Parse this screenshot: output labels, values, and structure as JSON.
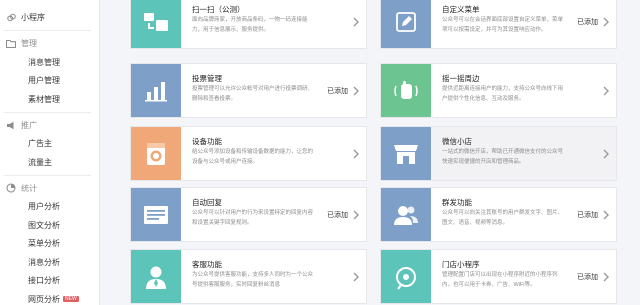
{
  "sidebar": {
    "top_item": {
      "label": "小程序",
      "icon": "mini-program-icon"
    },
    "groups": [
      {
        "title": "管理",
        "icon": "folder-icon",
        "items": [
          "消息管理",
          "用户管理",
          "素材管理"
        ]
      },
      {
        "title": "推广",
        "icon": "megaphone-icon",
        "items": [
          "广告主",
          "流量主"
        ]
      },
      {
        "title": "统计",
        "icon": "pie-chart-icon",
        "items": [
          "用户分析",
          "图文分析",
          "菜单分析",
          "消息分析",
          "接口分析",
          "网页分析"
        ]
      }
    ],
    "new_badge": "NEW"
  },
  "cards": [
    {
      "title": "扫一扫（公测）",
      "desc": "面向品牌商家，开放商品条码，一物一码连接能力，用于信息展示、服务提供。",
      "status": "",
      "color": "#5cc4b9",
      "icon": "scan-icon"
    },
    {
      "title": "自定义菜单",
      "desc": "公众号可以在会话界面底部设置自定义菜单，菜单项可以按需设定，并可为其设置响应动作。",
      "status": "已添加",
      "color": "#7d9fc8",
      "icon": "edit-icon"
    },
    {
      "title": "投票管理",
      "desc": "投票管理可以允许公众帐号对用户进行投票调研、删除和查看投票。",
      "status": "已添加",
      "color": "#7d9fc8",
      "icon": "bar-chart-icon"
    },
    {
      "title": "摇一摇周边",
      "desc": "提供近距离连接用户的能力，支持公众号向线下用户提供个性化信息、互动及服务。",
      "status": "",
      "color": "#6cc490",
      "icon": "shake-hand-icon"
    },
    {
      "title": "设备功能",
      "desc": "给公众号添加设备和传输设备数据的能力，让您的设备与公众号或用户连接。",
      "status": "",
      "color": "#f0a878",
      "icon": "washing-machine-icon"
    },
    {
      "title": "微信小店",
      "desc": "一站式的微信开店，帮助已开通微信支付的公众号快速实现便捷的开店和管理商品。",
      "status": "",
      "color": "#7d9fc8",
      "icon": "shop-icon"
    },
    {
      "title": "自动回复",
      "desc": "公众号可以针对用户的行为来设置特定的回复内容和设置关键字回复规则。",
      "status": "已添加",
      "color": "#7d9fc8",
      "icon": "auto-reply-icon"
    },
    {
      "title": "群发功能",
      "desc": "公众号可以向关注其账号的用户群发文字、图片、图文、语音、视频等消息。",
      "status": "已添加",
      "color": "#7d9fc8",
      "icon": "users-icon"
    },
    {
      "title": "客服功能",
      "desc": "为公众号提供客服功能，支持多人同时为一个公众号提供客服服务，实时回复粉丝消息",
      "status": "",
      "color": "#5cc4b9",
      "icon": "customer-service-icon"
    },
    {
      "title": "门店小程序",
      "desc": "管理配置门店可以出现在小程序附近的小程序列内，也可以用于卡券、广告、WiFi等。",
      "status": "已添加",
      "color": "#5cc4b9",
      "icon": "store-location-icon"
    }
  ],
  "selected_card": 5
}
